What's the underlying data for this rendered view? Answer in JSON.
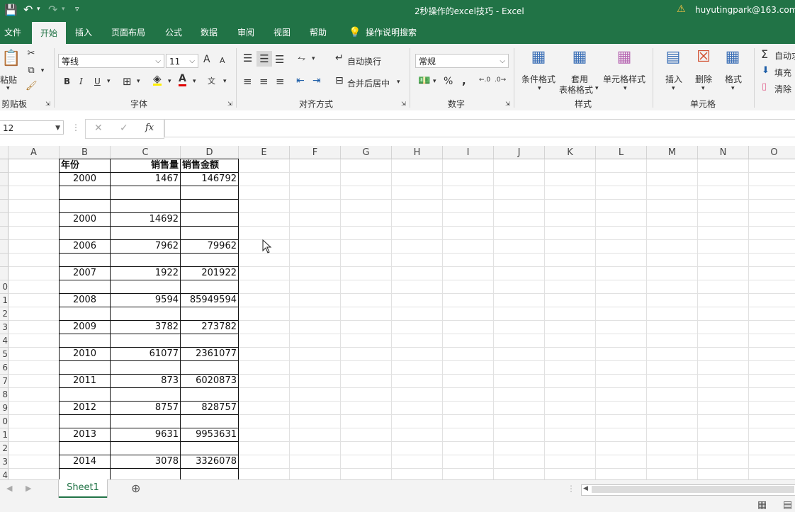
{
  "window": {
    "title": "2秒操作的excel技巧 - Excel",
    "user": "huyutingpark@163.com"
  },
  "tabs": [
    "文件",
    "开始",
    "插入",
    "页面布局",
    "公式",
    "数据",
    "审阅",
    "视图",
    "帮助",
    "操作说明搜索"
  ],
  "ribbon": {
    "clipboard": {
      "paste": "粘贴",
      "label": "剪贴板"
    },
    "font": {
      "name": "等线",
      "size": "11",
      "bold": "B",
      "italic": "I",
      "underline": "U",
      "label": "字体",
      "grow": "A",
      "shrink": "A"
    },
    "alignment": {
      "wrap": "自动换行",
      "merge": "合并后居中",
      "label": "对齐方式"
    },
    "number": {
      "format": "常规",
      "percent": "%",
      "comma": ",",
      "label": "数字"
    },
    "styles": {
      "conditional": "条件格式",
      "table1": "套用",
      "table2": "表格格式",
      "cell_styles": "单元格样式",
      "label": "样式"
    },
    "cells": {
      "insert": "插入",
      "delete": "删除",
      "format": "格式",
      "label": "单元格"
    },
    "editing": {
      "autosum": "自动求",
      "fill": "填充",
      "clear": "清除"
    }
  },
  "formula_bar": {
    "name_box": "12",
    "fx": "fx",
    "value": ""
  },
  "columns": [
    "A",
    "B",
    "C",
    "D",
    "E",
    "F",
    "G",
    "H",
    "I",
    "J",
    "K",
    "L",
    "M",
    "N",
    "O"
  ],
  "row_numbers": [
    "",
    "",
    "",
    "",
    "",
    "",
    "",
    "",
    "",
    "0",
    "1",
    "2",
    "3",
    "4",
    "5",
    "6",
    "7",
    "8",
    "9",
    "0",
    "1",
    "2",
    "3",
    "4"
  ],
  "table": {
    "headers": [
      "年份",
      "销售量",
      "销售金额"
    ],
    "rows": [
      [
        "2000",
        "1467",
        "146792"
      ],
      [
        "",
        "",
        ""
      ],
      [
        "",
        "",
        ""
      ],
      [
        "2000",
        "14692",
        ""
      ],
      [
        "",
        "",
        ""
      ],
      [
        "2006",
        "7962",
        "79962"
      ],
      [
        "",
        "",
        ""
      ],
      [
        "2007",
        "1922",
        "201922"
      ],
      [
        "",
        "",
        ""
      ],
      [
        "2008",
        "9594",
        "85949594"
      ],
      [
        "",
        "",
        ""
      ],
      [
        "2009",
        "3782",
        "273782"
      ],
      [
        "",
        "",
        ""
      ],
      [
        "2010",
        "61077",
        "2361077"
      ],
      [
        "",
        "",
        ""
      ],
      [
        "2011",
        "873",
        "6020873"
      ],
      [
        "",
        "",
        ""
      ],
      [
        "2012",
        "8757",
        "828757"
      ],
      [
        "",
        "",
        ""
      ],
      [
        "2013",
        "9631",
        "9953631"
      ],
      [
        "",
        "",
        ""
      ],
      [
        "2014",
        "3078",
        "3326078"
      ],
      [
        "",
        "",
        ""
      ]
    ]
  },
  "sheet_tabs": [
    "Sheet1"
  ],
  "colors": {
    "brand": "#217346",
    "ribbon": "#f3f3f3"
  }
}
